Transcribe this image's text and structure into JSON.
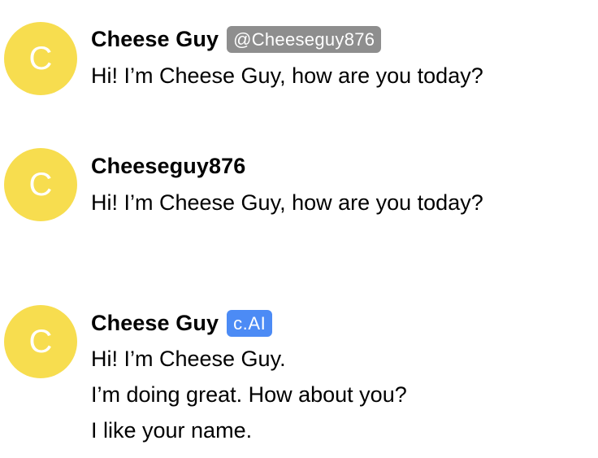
{
  "messages": [
    {
      "avatar_letter": "C",
      "name": "Cheese Guy",
      "badge": "@Cheeseguy876",
      "lines": [
        "Hi! I’m Cheese Guy, how are you today?"
      ]
    },
    {
      "avatar_letter": "C",
      "name": "Cheeseguy876",
      "lines": [
        "Hi! I’m Cheese Guy, how are you today?"
      ]
    },
    {
      "avatar_letter": "C",
      "name": "Cheese Guy",
      "badge": "c.AI",
      "lines": [
        "Hi! I’m Cheese Guy.",
        "I’m doing great. How about you?",
        "I like your name."
      ]
    }
  ],
  "colors": {
    "avatar": "#f7dd4f",
    "handle_badge": "#8e8e8e",
    "ai_badge": "#4c8bf5"
  }
}
